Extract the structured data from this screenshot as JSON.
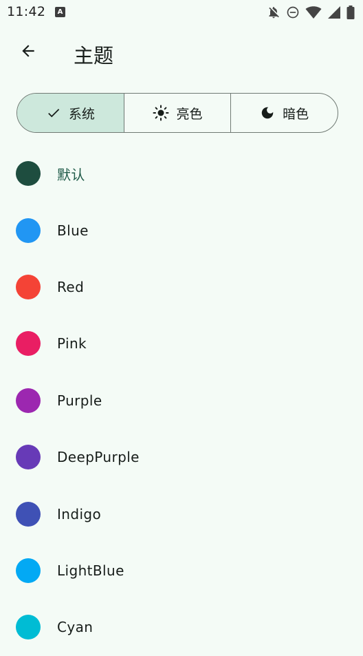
{
  "status_bar": {
    "time": "11:42",
    "app_icon_letter": "A",
    "icons": [
      "notifications-off-icon",
      "do-not-disturb-icon",
      "wifi-icon",
      "cellular-signal-icon",
      "battery-icon"
    ]
  },
  "app_bar": {
    "title": "主题",
    "back_icon": "arrow-back-icon"
  },
  "mode_selector": {
    "segments": [
      {
        "label": "系统",
        "icon": "check-icon",
        "selected": true
      },
      {
        "label": "亮色",
        "icon": "sun-icon",
        "selected": false
      },
      {
        "label": "暗色",
        "icon": "moon-icon",
        "selected": false
      }
    ]
  },
  "themes": [
    {
      "label": "默认",
      "color": "#1e4d3f",
      "active": true
    },
    {
      "label": "Blue",
      "color": "#2196f3",
      "active": false
    },
    {
      "label": "Red",
      "color": "#f44336",
      "active": false
    },
    {
      "label": "Pink",
      "color": "#e91e63",
      "active": false
    },
    {
      "label": "Purple",
      "color": "#9c27b0",
      "active": false
    },
    {
      "label": "DeepPurple",
      "color": "#673ab7",
      "active": false
    },
    {
      "label": "Indigo",
      "color": "#3f51b5",
      "active": false
    },
    {
      "label": "LightBlue",
      "color": "#03a9f4",
      "active": false
    },
    {
      "label": "Cyan",
      "color": "#00bcd4",
      "active": false
    }
  ],
  "colors": {
    "background": "#f4fbf6",
    "selected_segment": "#cde8dc",
    "outline": "#6f7973",
    "active_label": "#1e5a48"
  }
}
